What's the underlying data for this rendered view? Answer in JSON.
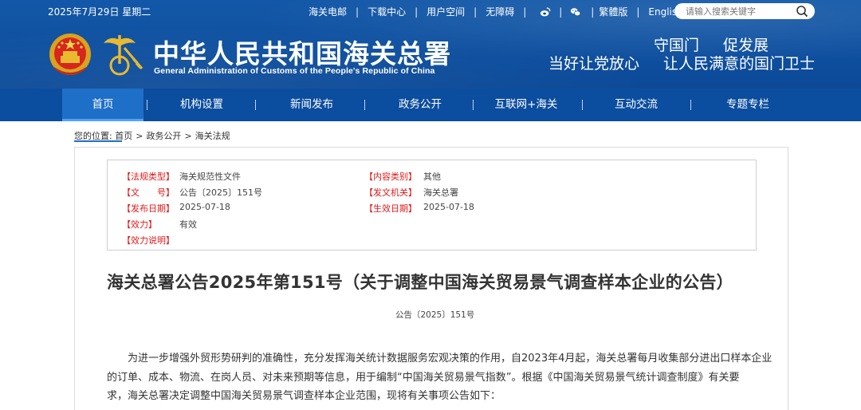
{
  "topbar": {
    "date": "2025年7月29日 星期二",
    "links": [
      "海关电邮",
      "下载中心",
      "用户空间",
      "无障碍"
    ],
    "icons": [
      "weibo-icon",
      "wechat-icon"
    ],
    "lang_links": [
      "繁體版",
      "English"
    ],
    "search_placeholder": "请输入搜索关键字"
  },
  "brand": {
    "title_cn": "中华人民共和国海关总署",
    "title_en": "General Administration of Customs of the People's Republic of China",
    "slogan_line1": [
      "守国门",
      "促发展"
    ],
    "slogan_line2": [
      "当好让党放心",
      "让人民满意的国门卫士"
    ]
  },
  "nav": {
    "items": [
      "首页",
      "机构设置",
      "新闻发布",
      "政务公开",
      "互联网+海关",
      "互动交流",
      "专题专栏"
    ],
    "active_index": 0
  },
  "breadcrumb": {
    "label": "您的位置:",
    "items": [
      "首页",
      "政务公开",
      "海关法规"
    ],
    "separator": ">"
  },
  "meta": {
    "left": [
      {
        "key": "【法规类型】",
        "value": "海关规范性文件"
      },
      {
        "key": "【文　　号】",
        "value": "公告〔2025〕151号"
      },
      {
        "key": "【发布日期】",
        "value": "2025-07-18"
      },
      {
        "key": "【效力】",
        "value": "有效"
      },
      {
        "key": "【效力说明】",
        "value": ""
      }
    ],
    "right": [
      {
        "key": "【内容类别】",
        "value": "其他"
      },
      {
        "key": "【发文机关】",
        "value": "海关总署"
      },
      {
        "key": "【生效日期】",
        "value": "2025-07-18"
      }
    ]
  },
  "document": {
    "title": "海关总署公告2025年第151号（关于调整中国海关贸易景气调查样本企业的公告）",
    "number": "公告〔2025〕151号",
    "lines": [
      "为进一步增强外贸形势研判的准确性，充分发挥海关统计数据服务宏观决策的作用，自2023年4月起，海关总署每月收集部分进出口样本企业",
      "的订单、成本、物流、在岗人员、对未来预期等信息，用于编制“中国海关贸易景气指数”。根据《中国海关贸易景气统计调查制度》有关要",
      "求，海关总署决定调整中国海关贸易景气调查样本企业范围，现将有关事项公告如下："
    ]
  },
  "colors": {
    "header_blue": "#0d4d9c",
    "nav_active": "#1e6fc8",
    "meta_key_red": "#e01a1a"
  }
}
